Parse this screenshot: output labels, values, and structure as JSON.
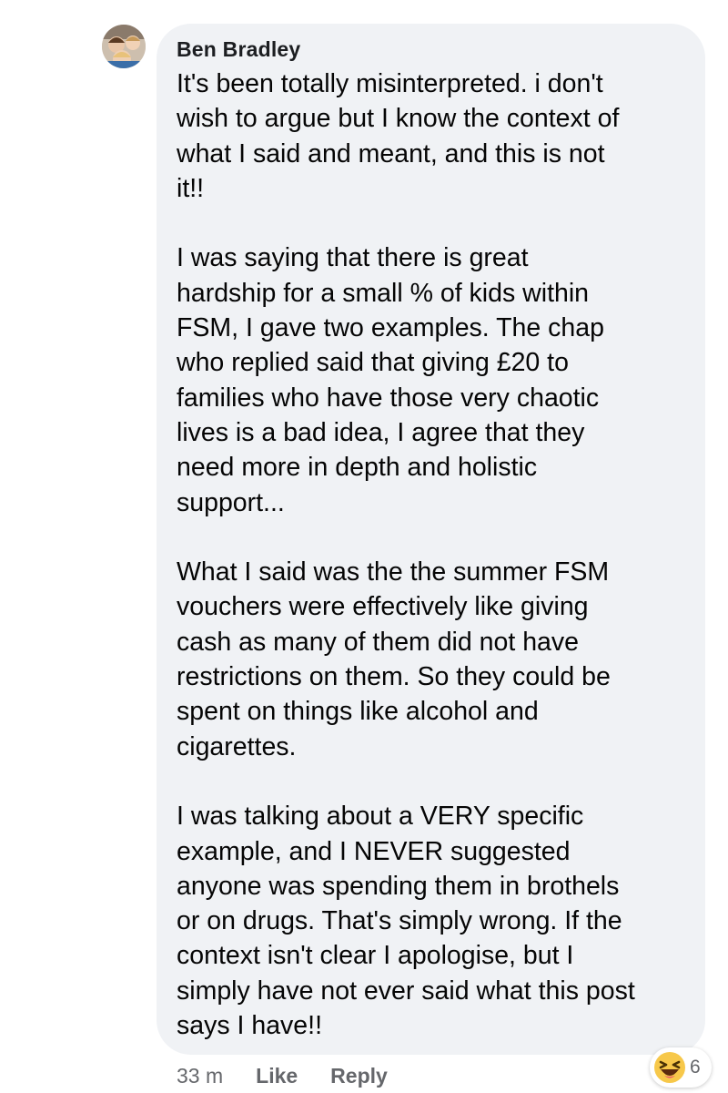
{
  "comment": {
    "author": "Ben Bradley",
    "paragraphs": [
      [
        "It's been totally misinterpreted. i don't",
        "wish to argue but I know the context of",
        "what I said and meant, and this is not",
        "it!!"
      ],
      [
        "I was saying that there is great",
        "hardship for a small % of kids within",
        "FSM, I gave two examples. The chap",
        "who replied said that giving £20 to",
        "families who have those very chaotic",
        "lives is a bad idea, I agree that they",
        "need more in depth and holistic",
        "support..."
      ],
      [
        "What I said was the the summer FSM",
        "vouchers were effectively like giving",
        "cash as many of them did not have",
        "restrictions on them. So they could be",
        "spent on things like alcohol and",
        "cigarettes."
      ],
      [
        "I was talking about a VERY specific",
        "example, and I NEVER suggested",
        "anyone was spending them in brothels",
        "or on drugs. That's simply wrong. If the",
        "context isn't clear I apologise, but I",
        "simply have not ever said what this post",
        "says I have!!"
      ]
    ]
  },
  "actions": {
    "time": "33 m",
    "like_label": "Like",
    "reply_label": "Reply"
  },
  "reactions": {
    "icon": "laughing-emoji-icon",
    "count": "6"
  },
  "colors": {
    "bubble": "#f0f2f5",
    "text": "#050505",
    "meta": "#65676b"
  }
}
